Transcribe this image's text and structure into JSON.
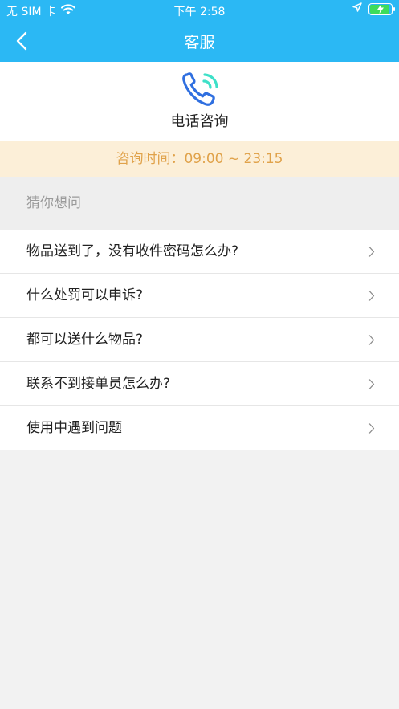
{
  "status_bar": {
    "carrier": "无 SIM 卡",
    "time": "下午 2:58",
    "wifi_icon": "wifi-icon",
    "location_icon": "location-arrow-icon",
    "battery_icon": "battery-charging-icon"
  },
  "nav": {
    "back_icon": "chevron-left-icon",
    "title": "客服"
  },
  "phone_consult": {
    "icon": "phone-ringing-icon",
    "label": "电话咨询"
  },
  "hours": {
    "text": "咨询时间：09:00 ~ 23:15"
  },
  "faq": {
    "section_title": "猜你想问",
    "items": [
      {
        "label": "物品送到了，没有收件密码怎么办?"
      },
      {
        "label": "什么处罚可以申诉?"
      },
      {
        "label": "都可以送什么物品?"
      },
      {
        "label": "联系不到接单员怎么办?"
      },
      {
        "label": "使用中遇到问题"
      }
    ],
    "chevron_icon": "chevron-right-icon"
  },
  "colors": {
    "header": "#2bb8f4",
    "hours_bg": "#fcefd8",
    "hours_text": "#e0a24a",
    "phone_icon_blue": "#2f6fe0",
    "phone_icon_teal": "#3ee0c8"
  }
}
